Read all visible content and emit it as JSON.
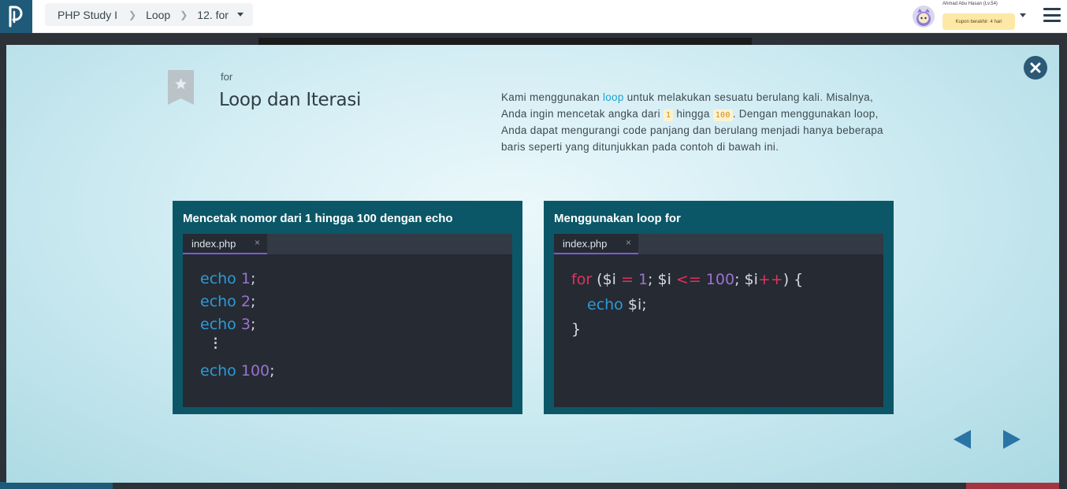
{
  "app": {
    "logo_icon": "progate-logo-icon",
    "breadcrumb": [
      "PHP Study I",
      "Loop",
      "12. for"
    ]
  },
  "user": {
    "name": "Ahmad Abu Hasan (Lv.54)",
    "coupon": "Kupon berakhir: 4 hari"
  },
  "slide": {
    "kicker": "for",
    "title": "Loop dan Iterasi",
    "description": {
      "p1": "Kami menggunakan ",
      "kw": "loop",
      "p2": " untuk melakukan sesuatu berulang kali. Misalnya, Anda ingin mencetak angka dari ",
      "c1": "1",
      "p3": " hingga ",
      "c2": "100",
      "p4": ". Dengan menggunakan loop, Anda dapat mengurangi code panjang dan berulang menjadi hanya beberapa baris seperti yang ditunjukkan pada contoh di bawah ini."
    },
    "cards": [
      {
        "title": "Mencetak nomor dari 1 hingga 100 dengan echo",
        "tab": "index.php",
        "lines": [
          {
            "kw": "echo",
            "num": "1",
            "end": ";"
          },
          {
            "kw": "echo",
            "num": "2",
            "end": ";"
          },
          {
            "kw": "echo",
            "num": "3",
            "end": ";"
          },
          {
            "kw": "echo",
            "num": "100",
            "end": ";"
          }
        ],
        "ellipsis": "⋮"
      },
      {
        "title": "Menggunakan loop for",
        "tab": "index.php",
        "line1": {
          "for": "for",
          "open": " ($i ",
          "eq": "=",
          "sp1": " ",
          "one": "1",
          "mid": "; $i ",
          "le": "<=",
          "sp2": " ",
          "hundred": "100",
          "semi": "; $i",
          "inc": "++",
          "close": ") {"
        },
        "line2": {
          "kw": "echo",
          "rest": " $i;"
        },
        "line3": "}"
      }
    ]
  },
  "colors": {
    "accent": "#2a74a6",
    "card_bg": "#0c5767",
    "editor_bg": "#262a33",
    "keyword_blue": "#2d9bd6",
    "number_purple": "#9b72ce",
    "operator_red": "#e2335d"
  }
}
